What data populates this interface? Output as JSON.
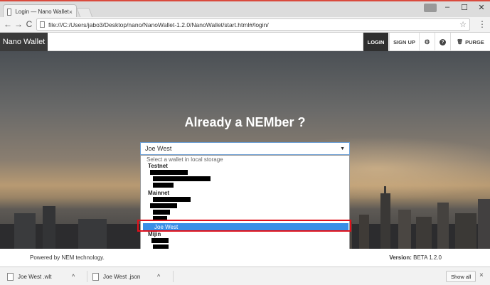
{
  "browser": {
    "tab_title": "Login — Nano Wallet",
    "tab_close": "×",
    "url": "file:///C:/Users/jabo3/Desktop/nano/NanoWallet-1.2.0/NanoWallet/start.html#/login/",
    "window_controls": {
      "minimize": "–",
      "maximize": "☐",
      "close": "✕"
    },
    "nav": {
      "back": "←",
      "forward": "→",
      "reload": "C"
    },
    "star": "☆",
    "menu": "⋮"
  },
  "app": {
    "brand": "Nano Wallet",
    "nav": {
      "login": "LOGIN",
      "signup": "SIGN UP",
      "settings_icon": "⚙",
      "help_icon": "?",
      "purge": "PURGE",
      "purge_icon": "🗑"
    }
  },
  "hero": {
    "headline": "Already a NEMber ?"
  },
  "wallet_select": {
    "value": "Joe West",
    "caret": "▼",
    "placeholder": "Select a wallet in local storage",
    "groups": {
      "testnet": "Testnet",
      "mainnet": "Mainnet",
      "mijin": "Mijin"
    },
    "selected_item": "Joe West"
  },
  "footer": {
    "powered": "Powered by NEM technology.",
    "version_label": "Version:",
    "version_value": "BETA 1.2.0"
  },
  "downloads": {
    "items": [
      {
        "name": "Joe West .wlt",
        "caret": "^"
      },
      {
        "name": "Joe West .json",
        "caret": "^"
      }
    ],
    "show_all": "Show all",
    "close": "×"
  },
  "colors": {
    "highlight": "#e0101a",
    "selected": "#3a8ee6",
    "nav_active": "#2f2f2f"
  }
}
